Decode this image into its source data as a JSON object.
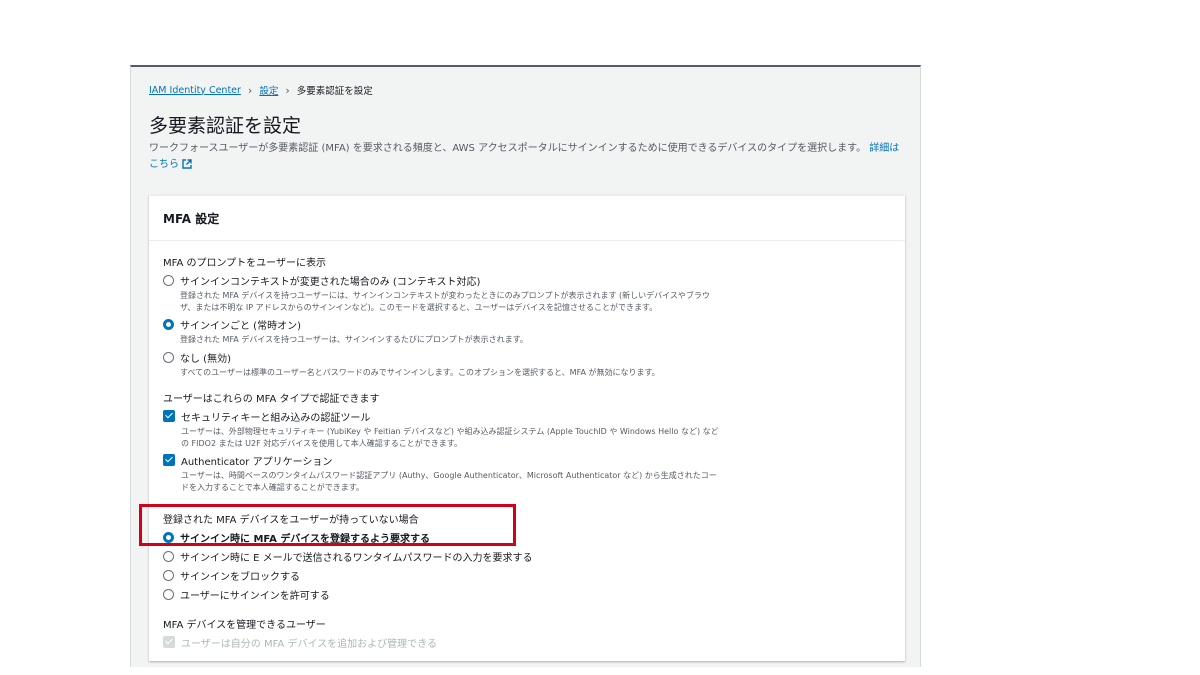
{
  "breadcrumb": {
    "root": "IAM Identity Center",
    "settings": "設定",
    "current": "多要素認証を設定"
  },
  "page": {
    "title": "多要素認証を設定",
    "description": "ワークフォースユーザーが多要素認証 (MFA) を要求される頻度と、AWS アクセスポータルにサインインするために使用できるデバイスのタイプを選択します。",
    "learn_more": "詳細はこちら"
  },
  "panel": {
    "title": "MFA 設定",
    "prompt_section": {
      "label": "MFA のプロンプトをユーザーに表示",
      "options": [
        {
          "label": "サインインコンテキストが変更された場合のみ (コンテキスト対応)",
          "desc": "登録された MFA デバイスを持つユーザーには、サインインコンテキストが変わったときにのみプロンプトが表示されます (新しいデバイスやブラウザ、または不明な IP アドレスからのサインインなど)。このモードを選択すると、ユーザーはデバイスを記憶させることができます。",
          "selected": false
        },
        {
          "label": "サインインごと (常時オン)",
          "desc": "登録された MFA デバイスを持つユーザーは、サインインするたびにプロンプトが表示されます。",
          "selected": true
        },
        {
          "label": "なし (無効)",
          "desc": "すべてのユーザーは標準のユーザー名とパスワードのみでサインインします。このオプションを選択すると、MFA が無効になります。",
          "selected": false
        }
      ]
    },
    "types_section": {
      "label": "ユーザーはこれらの MFA タイプで認証できます",
      "options": [
        {
          "label": "セキュリティキーと組み込みの認証ツール",
          "desc": "ユーザーは、外部物理セキュリティキー (YubiKey や Feitian デバイスなど) や組み込み認証システム (Apple TouchID や Windows Hello など) などの FIDO2 または U2F 対応デバイスを使用して本人確認することができます。",
          "checked": true
        },
        {
          "label": "Authenticator アプリケーション",
          "desc": "ユーザーは、時間ベースのワンタイムパスワード認証アプリ (Authy、Google Authenticator、Microsoft Authenticator など) から生成されたコードを入力することで本人確認することができます。",
          "checked": true
        }
      ]
    },
    "no_device_section": {
      "label": "登録された MFA デバイスをユーザーが持っていない場合",
      "options": [
        {
          "label": "サインイン時に MFA デバイスを登録するよう要求する",
          "selected": true
        },
        {
          "label": "サインイン時に E メールで送信されるワンタイムパスワードの入力を要求する",
          "selected": false
        },
        {
          "label": "サインインをブロックする",
          "selected": false
        },
        {
          "label": "ユーザーにサインインを許可する",
          "selected": false
        }
      ]
    },
    "manage_section": {
      "label": "MFA デバイスを管理できるユーザー",
      "option": "ユーザーは自分の MFA デバイスを追加および管理できる"
    }
  },
  "colors": {
    "link": "#0073bb",
    "highlight_border": "#d0021b",
    "background": "#f2f3f3"
  }
}
